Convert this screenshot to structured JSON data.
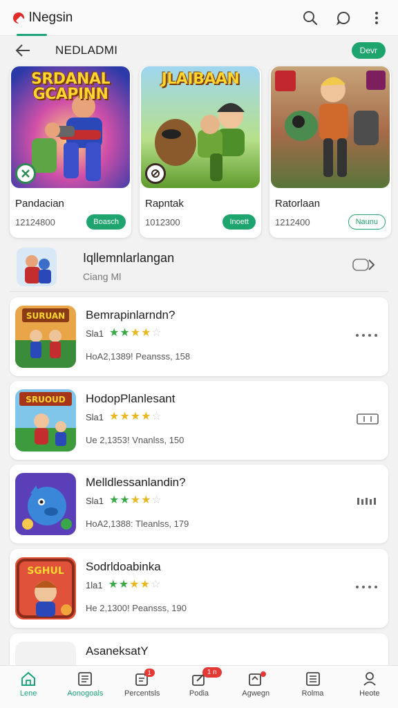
{
  "app": {
    "title": "lNegsin"
  },
  "header": {
    "icons": [
      "search-icon",
      "chat-icon",
      "more-vert-icon"
    ]
  },
  "subheader": {
    "title": "NEDLADMI",
    "pill": "Devr"
  },
  "featured": [
    {
      "art_title": "SRDANAL GCAPINN",
      "name": "Pandacian",
      "number": "12124800",
      "button": "Boasch",
      "button_style": "filled"
    },
    {
      "art_title": "JLAIBAAN",
      "name": "Rapntak",
      "number": "1012300",
      "button": "Inoett",
      "button_style": "filled"
    },
    {
      "art_title": "",
      "name": "Ratorlaan",
      "number": "1212400",
      "button": "Naunu",
      "button_style": "outline"
    }
  ],
  "section": {
    "title": "Iqllemnlarlangan",
    "subtitle": "Ciang  Ml"
  },
  "list": [
    {
      "title": "Bemrapinlarndn?",
      "rating_label": "Sla1",
      "stars": 4,
      "star_color": "green",
      "meta": "HoA2,1389!  Peansss,  158",
      "action": "dots"
    },
    {
      "title": "HodopPlanlesant",
      "rating_label": "Sla1",
      "stars": 4,
      "star_color": "yellow",
      "meta": "Ue 2,1353!  Vnanlss,  150",
      "action": "box"
    },
    {
      "title": "Melldlessanlandin?",
      "rating_label": "Sla1",
      "stars": 4,
      "star_color": "green",
      "meta": "HoA2,1388:  Tleanlss,  179",
      "action": "bars"
    },
    {
      "title": "Sodrldoabinka",
      "rating_label": "1la1",
      "stars": 4,
      "star_color": "green",
      "meta": "He 2,1300!  Peansss,  190",
      "action": "dots"
    },
    {
      "title": "AsaneksatY",
      "rating_label": "",
      "stars": 0,
      "star_color": "green",
      "meta": "",
      "action": "none"
    }
  ],
  "nav": [
    {
      "label": "Lene",
      "icon": "home-icon",
      "active": true
    },
    {
      "label": "Aonogoals",
      "icon": "document-icon",
      "active": false
    },
    {
      "label": "Percentsls",
      "icon": "edit-document-icon",
      "active": false,
      "badge": "1"
    },
    {
      "label": "Podia",
      "icon": "send-icon",
      "active": false,
      "badge": "1 n"
    },
    {
      "label": "Agwegn",
      "icon": "upload-icon",
      "active": false,
      "dot": true
    },
    {
      "label": "Rolma",
      "icon": "list-icon",
      "active": false
    },
    {
      "label": "Heote",
      "icon": "person-icon",
      "active": false
    }
  ],
  "colors": {
    "accent": "#1ea46d",
    "brand_red": "#e12b2b",
    "badge_red": "#e53935"
  }
}
